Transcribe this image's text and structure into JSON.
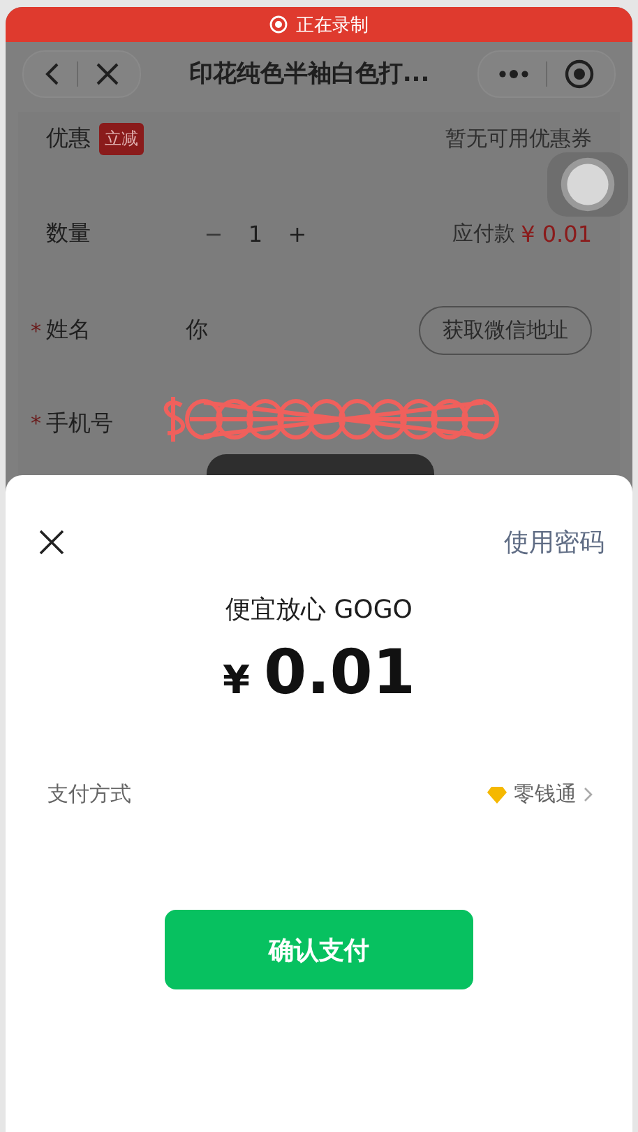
{
  "recording_banner": {
    "label": "正在录制"
  },
  "nav": {
    "title": "印花纯色半袖白色打..."
  },
  "coupon": {
    "label": "优惠",
    "tag": "立减",
    "value": "暂无可用优惠券"
  },
  "quantity": {
    "label": "数量",
    "minus": "−",
    "count": "1",
    "plus": "+",
    "total_label": "应付款",
    "total": "¥ 0.01"
  },
  "form_fields": [
    {
      "marker": "*",
      "label": "姓名",
      "value": "你",
      "button": "获取微信地址"
    },
    {
      "marker": "*",
      "label": "手机号"
    }
  ],
  "payment_sheet": {
    "link": "使用密码",
    "merchant": "便宜放心 GOGO",
    "currency": "¥",
    "amount": "0.01",
    "method_label": "支付方式",
    "method": "零钱通",
    "confirm": "确认支付"
  }
}
